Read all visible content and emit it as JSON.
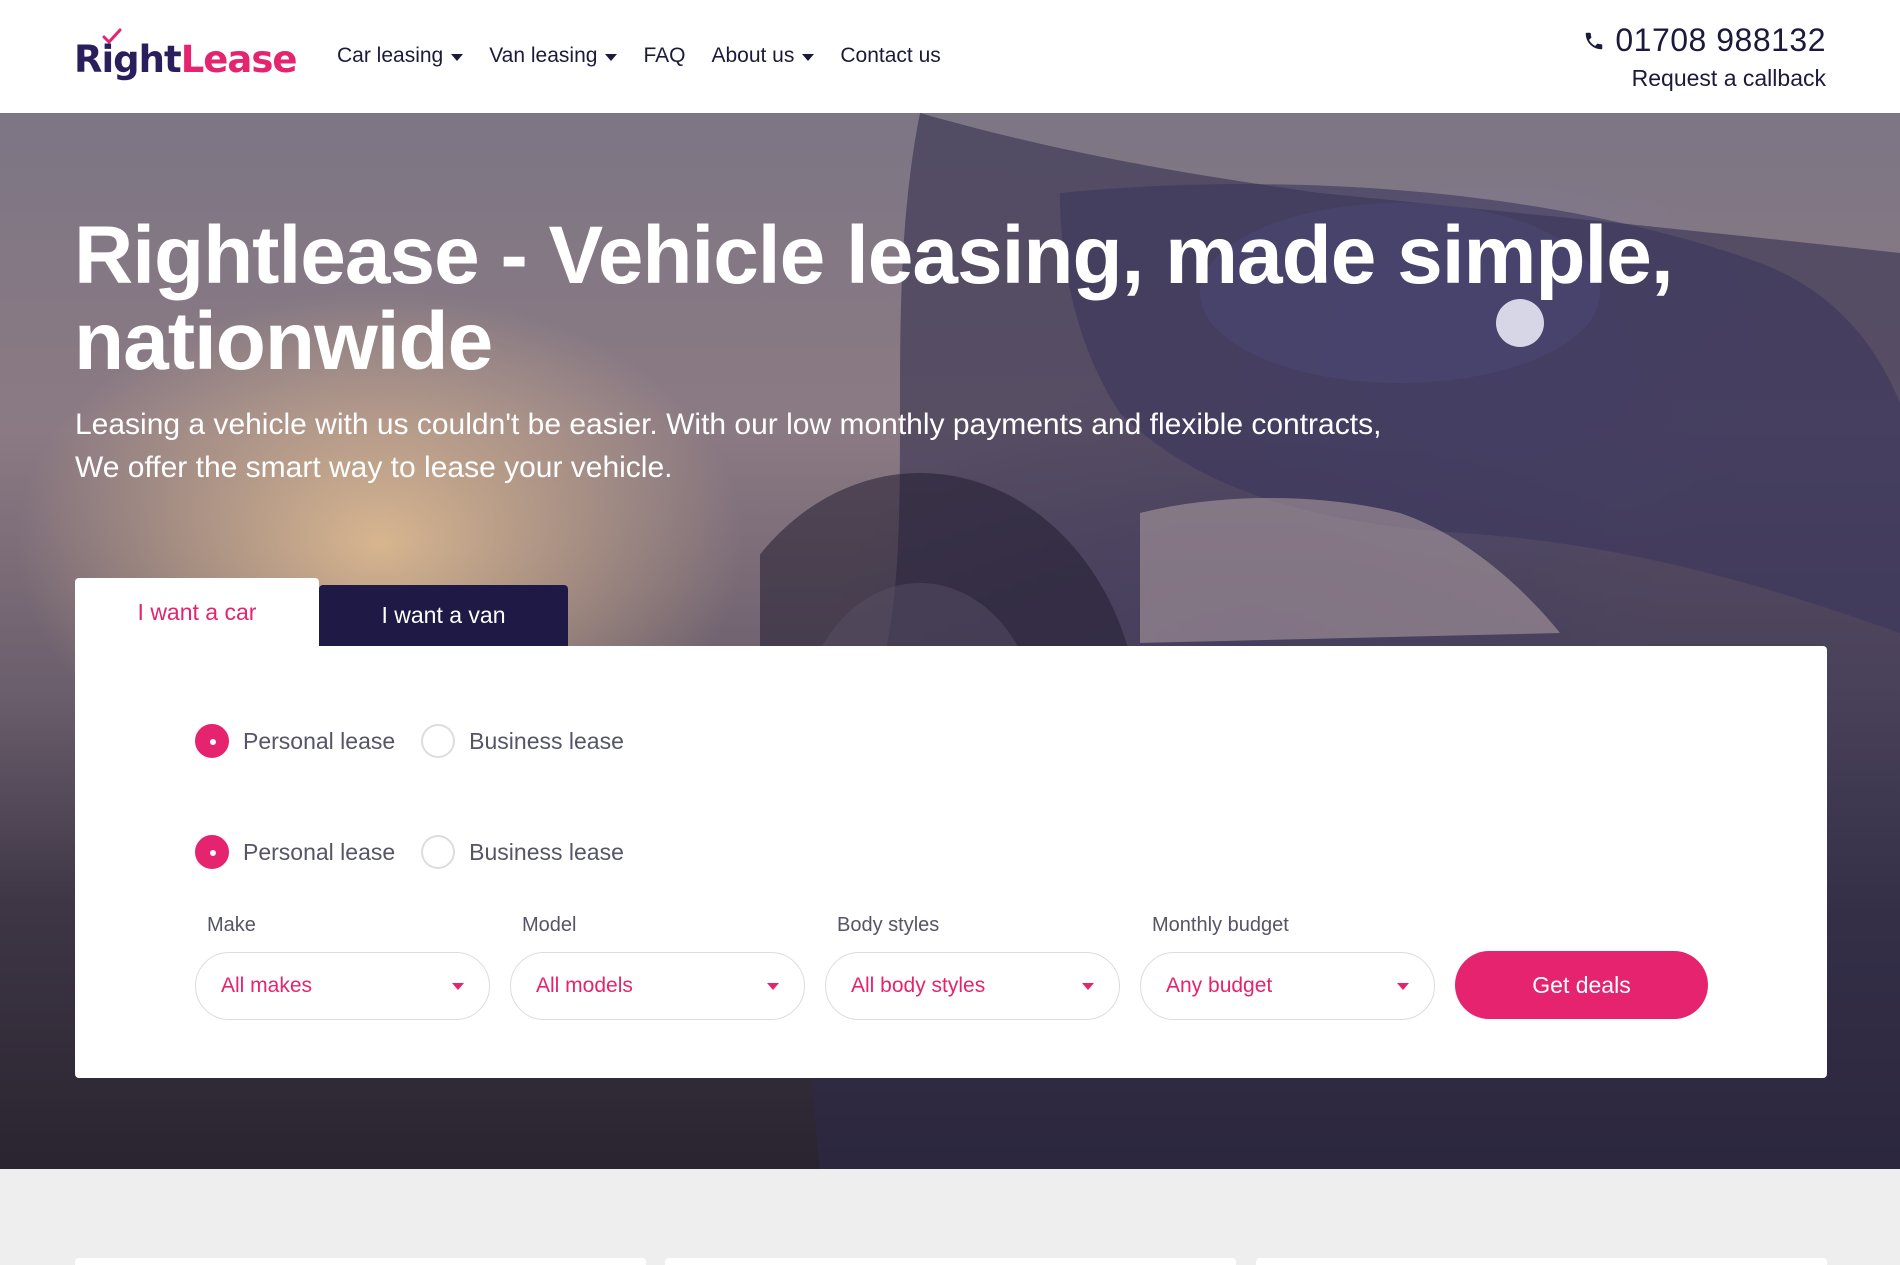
{
  "brand": {
    "logo_right": "Right",
    "logo_lease": "Lease",
    "primary_color": "#e5236f",
    "navy_color": "#1e1a45"
  },
  "nav": {
    "items": [
      {
        "label": "Car leasing",
        "has_dropdown": true
      },
      {
        "label": "Van leasing",
        "has_dropdown": true
      },
      {
        "label": "FAQ",
        "has_dropdown": false
      },
      {
        "label": "About us",
        "has_dropdown": true
      },
      {
        "label": "Contact us",
        "has_dropdown": false
      }
    ]
  },
  "contact": {
    "phone_icon": "phone-icon",
    "phone": "01708 988132",
    "callback": "Request a callback"
  },
  "hero": {
    "title": "Rightlease - Vehicle leasing, made simple, nationwide",
    "subtitle": "Leasing a vehicle with us couldn't be easier. With our low monthly payments and flexible contracts, We offer the smart way to lease your vehicle."
  },
  "tabs": {
    "car": "I want a car",
    "van": "I want a van",
    "active": "car"
  },
  "search": {
    "lease_options_1": [
      {
        "label": "Personal lease",
        "checked": true
      },
      {
        "label": "Business lease",
        "checked": false
      }
    ],
    "lease_options_2": [
      {
        "label": "Personal lease",
        "checked": true
      },
      {
        "label": "Business lease",
        "checked": false
      }
    ],
    "fields": [
      {
        "label": "Make",
        "value": "All makes"
      },
      {
        "label": "Model",
        "value": "All models"
      },
      {
        "label": "Body styles",
        "value": "All body styles"
      },
      {
        "label": "Monthly budget",
        "value": "Any budget"
      }
    ],
    "submit": "Get deals"
  }
}
